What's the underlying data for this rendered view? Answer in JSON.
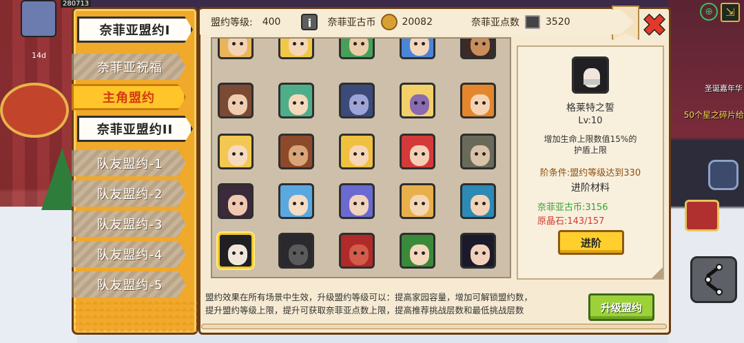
{
  "hud": {
    "currency_top": "280713",
    "day_tag": "14d",
    "event_text": "圣诞嘉年华",
    "event_text2": "50个星之碎片给"
  },
  "tabs": [
    {
      "label": "奈菲亚盟约I",
      "state": "main"
    },
    {
      "label": "奈菲亚祝福",
      "state": "dim"
    },
    {
      "label": "主角盟约",
      "state": "active"
    },
    {
      "label": "奈菲亚盟约II",
      "state": "main"
    },
    {
      "label": "队友盟约-1",
      "state": "dim"
    },
    {
      "label": "队友盟约-2",
      "state": "dim"
    },
    {
      "label": "队友盟约-3",
      "state": "dim"
    },
    {
      "label": "队友盟约-4",
      "state": "dim"
    },
    {
      "label": "队友盟约-5",
      "state": "dim"
    }
  ],
  "topbar": {
    "level_label": "盟约等级:",
    "level_value": "400",
    "info_icon": "i",
    "coin_label": "奈菲亚古币",
    "coin_value": "20082",
    "points_label": "奈菲亚点数",
    "points_value": "3520"
  },
  "close_icon": "✖",
  "grid": {
    "rows": [
      [
        {
          "hair": "#e8b55a",
          "skin": "#f4d3b4"
        },
        {
          "hair": "#f0c848",
          "skin": "#f5d7b7"
        },
        {
          "hair": "#46a05a",
          "skin": "#e9cca8"
        },
        {
          "hair": "#4a86d8",
          "skin": "#f3d6bc"
        },
        {
          "hair": "#3a2a28",
          "skin": "#c98e5c"
        }
      ],
      [
        {
          "hair": "#7a4a34",
          "skin": "#f0cdb0"
        },
        {
          "hair": "#4fae8a",
          "skin": "#f5d8bc"
        },
        {
          "hair": "#3c4a7a",
          "skin": "#9da4d8"
        },
        {
          "hair": "#f3d06a",
          "skin": "#8a6ab0"
        },
        {
          "hair": "#e3862e",
          "skin": "#f5d3b2"
        }
      ],
      [
        {
          "hair": "#f2c850",
          "skin": "#f6dac0"
        },
        {
          "hair": "#8c4a2a",
          "skin": "#d8a478"
        },
        {
          "hair": "#f0c040",
          "skin": "#f6d6b6"
        },
        {
          "hair": "#d43a3a",
          "skin": "#f4cfb4"
        },
        {
          "hair": "#6a6a5a",
          "skin": "#d8c2a8"
        }
      ],
      [
        {
          "hair": "#3a2a3a",
          "skin": "#f0c8b0"
        },
        {
          "hair": "#5aa8e0",
          "skin": "#f5dbc2"
        },
        {
          "hair": "#6a6ad0",
          "skin": "#f1d2bc"
        },
        {
          "hair": "#e8b04a",
          "skin": "#f5d6b4"
        },
        {
          "hair": "#2c8ab4",
          "skin": "#f2d2b8"
        }
      ],
      [
        {
          "hair": "#1f1f24",
          "skin": "#f2e6dc",
          "selected": true
        },
        {
          "hair": "#2a2a2e",
          "skin": "#5a5a5a"
        },
        {
          "hair": "#b02a2a",
          "skin": "#d45a4a"
        },
        {
          "hair": "#3a8a3a",
          "skin": "#f4d8bc"
        },
        {
          "hair": "#1a1a2a",
          "skin": "#f2d0bc"
        }
      ]
    ]
  },
  "detail": {
    "name": "格莱特之誓",
    "level": "Lv:10",
    "description_line1": "增加生命上限数值15%的",
    "description_line2": "护盾上限",
    "requirement": "阶条件:盟约等级达到330",
    "materials_title": "进阶材料",
    "coin_req": "奈菲亚古币:3156",
    "crystal_req": "原晶石:143/157",
    "advance_label": "进阶"
  },
  "bottom": {
    "line1": "盟约效果在所有场景中生效，升级盟约等级可以：提高家园容量，增加可解锁盟约数，",
    "line2": "提升盟约等级上限，提升可获取奈菲亚点数上限，提高推荐挑战层数和最低挑战层数",
    "upgrade_label": "升级盟约"
  },
  "colors": {
    "rail": "#f0a92a",
    "panel": "#f6ead2",
    "coin_green": "#36a236",
    "crystal_red": "#d23c2c",
    "upgrade_green": "#9dd13a"
  }
}
